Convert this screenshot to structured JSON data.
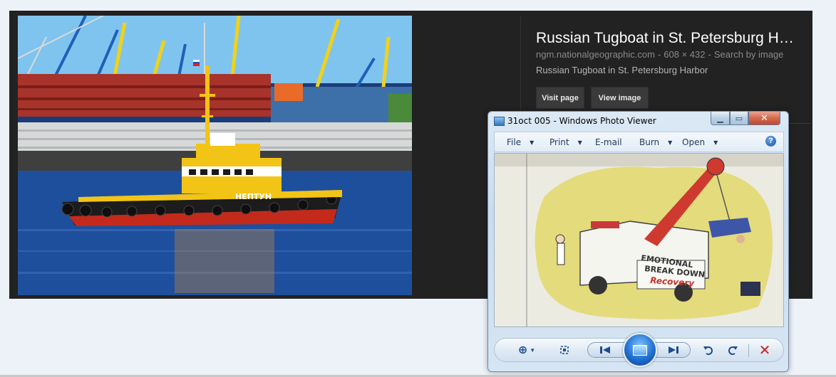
{
  "google_panel": {
    "title": "Russian Tugboat in St. Petersburg H…",
    "source": "ngm.nationalgeographic.com",
    "dimensions": "608 × 432",
    "search_by_image": "Search by image",
    "description": "Russian Tugboat in St. Petersburg Harbor",
    "visit_page_label": "Visit page",
    "view_image_label": "View image",
    "photo": {
      "boat_name": "НЕПТУН"
    }
  },
  "photo_viewer": {
    "title": "31oct 005 - Windows Photo Viewer",
    "menu": {
      "file": "File",
      "print": "Print",
      "email": "E-mail",
      "burn": "Burn",
      "open": "Open"
    },
    "help": "?",
    "image_text": {
      "line1": "EMOTIONAL",
      "line2": "BREAK DOWN",
      "line3": "Recovery"
    },
    "toolbar": {
      "zoom": "zoom-icon",
      "actual_size": "fit-icon",
      "previous": "previous-icon",
      "slideshow": "slideshow-icon",
      "next": "next-icon",
      "rotate_left": "rotate-ccw-icon",
      "rotate_right": "rotate-cw-icon",
      "delete": "delete-icon"
    }
  }
}
